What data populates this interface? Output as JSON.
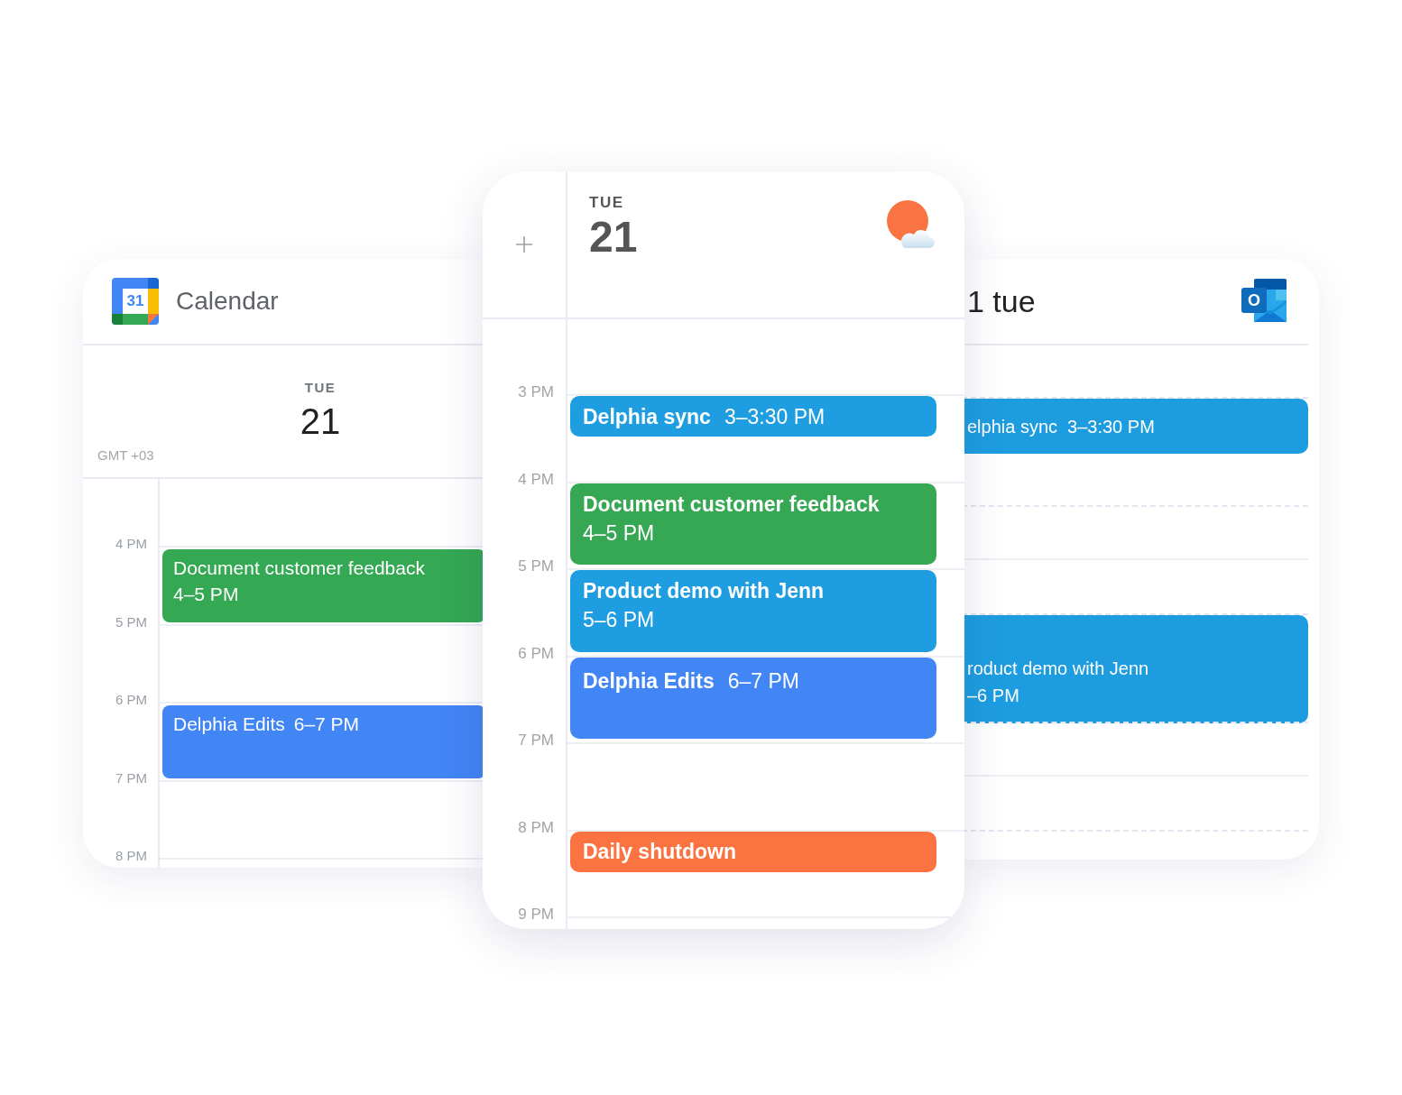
{
  "cards": [
    {
      "kind": "google",
      "logo_text": "31",
      "app_name": "Calendar",
      "day": "TUE",
      "date": "21",
      "timezone": "GMT +03",
      "rows": [
        {
          "label": "4 PM",
          "events": [
            {
              "kind": "stacked",
              "title": "Document customer feedback",
              "time": "4–5 PM",
              "color": "#34a853"
            }
          ]
        },
        {
          "label": "5 PM"
        },
        {
          "label": "6 PM",
          "events": [
            {
              "kind": "inline",
              "title": "Delphia Edits",
              "time": "6–7 PM",
              "color": "#4285f4"
            }
          ]
        },
        {
          "label": "7 PM"
        },
        {
          "label": "8 PM"
        }
      ]
    },
    {
      "kind": "main",
      "day": "TUE",
      "date": "21",
      "rows": [
        {
          "label": "3 PM",
          "events": [
            {
              "kind": "half",
              "title": "Delphia sync",
              "time": "3–3:30 PM",
              "color": "#1e9de0"
            }
          ]
        },
        {
          "label": "4 PM",
          "events": [
            {
              "kind": "stacked",
              "title": "Document customer feedback",
              "time": "4–5 PM",
              "color": "#36a853"
            }
          ]
        },
        {
          "label": "5 PM",
          "events": [
            {
              "kind": "stacked",
              "title": "Product demo with Jenn",
              "time": "5–6 PM",
              "color": "#1e9de0"
            }
          ]
        },
        {
          "label": "6 PM",
          "events": [
            {
              "kind": "inline",
              "title": "Delphia Edits",
              "time": "6–7 PM",
              "color": "#4285f4"
            }
          ]
        },
        {
          "label": "7 PM"
        },
        {
          "label": "8 PM",
          "events": [
            {
              "kind": "half",
              "title": "Daily shutdown",
              "color": "#fb7341"
            }
          ]
        },
        {
          "label": "9 PM"
        }
      ]
    },
    {
      "kind": "outlook",
      "heading": "1 tue",
      "logo_text": "O",
      "rows": [
        {
          "events": [
            {
              "kind": "half",
              "title": "elphia sync",
              "time": "3–3:30 PM",
              "color": "#1d9de0"
            }
          ]
        },
        {},
        {
          "events": [
            {
              "kind": "stacked",
              "title": "roduct demo with Jenn",
              "time": "–6 PM",
              "color": "#1d9de0"
            }
          ]
        },
        {},
        {}
      ]
    }
  ]
}
